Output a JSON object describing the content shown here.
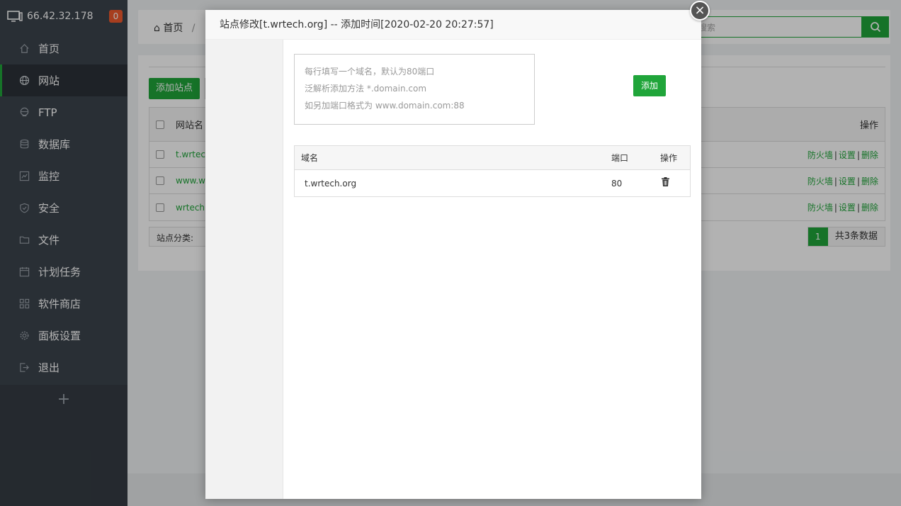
{
  "sidebar": {
    "ip": "66.42.32.178",
    "badge": "0",
    "items": [
      {
        "label": "首页",
        "icon": "home-icon"
      },
      {
        "label": "网站",
        "icon": "globe-icon"
      },
      {
        "label": "FTP",
        "icon": "ftp-icon"
      },
      {
        "label": "数据库",
        "icon": "database-icon"
      },
      {
        "label": "监控",
        "icon": "monitor-icon"
      },
      {
        "label": "安全",
        "icon": "shield-icon"
      },
      {
        "label": "文件",
        "icon": "folder-icon"
      },
      {
        "label": "计划任务",
        "icon": "calendar-icon"
      },
      {
        "label": "软件商店",
        "icon": "apps-icon"
      },
      {
        "label": "面板设置",
        "icon": "gear-icon"
      },
      {
        "label": "退出",
        "icon": "logout-icon"
      }
    ],
    "add": "+"
  },
  "topbar": {
    "breadcrumb_home": "首页",
    "breadcrumb_sep": "/",
    "search_placeholder": "搜索"
  },
  "sites": {
    "add_site": "添加站点",
    "col_name": "网站名",
    "col_ops": "操作",
    "rows": [
      {
        "name": "t.wrtech"
      },
      {
        "name": "www.wr"
      },
      {
        "name": "wrtech.c"
      }
    ],
    "op_firewall": "防火墙",
    "op_settings": "设置",
    "op_delete": "删除",
    "op_sep": "|",
    "category_label": "站点分类:",
    "page_current": "1",
    "total": "共3条数据"
  },
  "modal": {
    "title": "站点修改[t.wrtech.org] -- 添加时间[2020-02-20 20:27:57]",
    "close": "×",
    "textarea_lines": [
      "每行填写一个域名，默认为80端口",
      "泛解析添加方法 *.domain.com",
      "如另加端口格式为 www.domain.com:88"
    ],
    "add_button": "添加",
    "table": {
      "col_domain": "域名",
      "col_port": "端口",
      "col_op": "操作",
      "rows": [
        {
          "domain": "t.wrtech.org",
          "port": "80"
        }
      ]
    }
  },
  "colors": {
    "accent": "#20a53a",
    "sidebar_bg": "#3c444d",
    "badge": "#f0592d"
  }
}
